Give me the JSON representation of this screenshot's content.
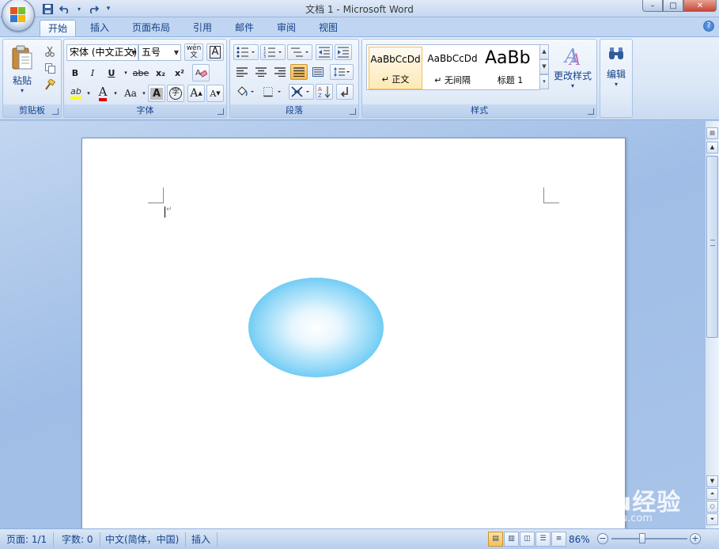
{
  "window": {
    "title": "文档 1 - Microsoft Word",
    "controls": {
      "minimize": "–",
      "maximize": "□",
      "close": "✕"
    }
  },
  "qat": {
    "save_icon": "floppy-disk-icon",
    "undo_icon": "undo-icon",
    "redo_icon": "redo-icon",
    "more": "▾"
  },
  "tabs": [
    "开始",
    "插入",
    "页面布局",
    "引用",
    "邮件",
    "审阅",
    "视图"
  ],
  "active_tab": "开始",
  "ribbon": {
    "clipboard": {
      "label": "剪贴板",
      "paste": "粘贴"
    },
    "font": {
      "label": "字体",
      "font_name": "宋体 (中文正文)",
      "font_size": "五号",
      "bold": "B",
      "italic": "I",
      "underline": "U",
      "strike": "abe",
      "subscript": "x₂",
      "superscript": "x²",
      "change_case": "Aa",
      "grow": "A",
      "shrink": "A",
      "font_color": "A",
      "highlight": "ab",
      "clear_fmt": "A",
      "enclose": "字",
      "phonetic": "wén 文"
    },
    "paragraph": {
      "label": "段落"
    },
    "styles": {
      "label": "样式",
      "items": [
        {
          "sample": "AaBbCcDd",
          "name": "↵ 正文"
        },
        {
          "sample": "AaBbCcDd",
          "name": "↵ 无间隔"
        },
        {
          "sample": "AaBb",
          "name": "标题 1"
        }
      ],
      "change_styles": "更改样式"
    },
    "editing": {
      "label": "编辑"
    }
  },
  "document": {
    "para_mark": "↵",
    "shape": {
      "type": "ellipse",
      "fill": "radial-gradient",
      "inner_color": "#ffffff",
      "outer_color": "#1fb0ef"
    }
  },
  "statusbar": {
    "page": "页面: 1/1",
    "words": "字数: 0",
    "language": "中文(简体，中国)",
    "mode": "插入",
    "zoom": "86%",
    "zoom_minus": "−",
    "zoom_plus": "+"
  },
  "watermark": {
    "brand": "Baidu经验",
    "url": "jingyan.baidu.com"
  },
  "colors": {
    "ribbon_bg": "#dbe7f6",
    "workspace_bg": "#abc6e8",
    "accent_text": "#15428b",
    "selected": "#f5b94a"
  }
}
